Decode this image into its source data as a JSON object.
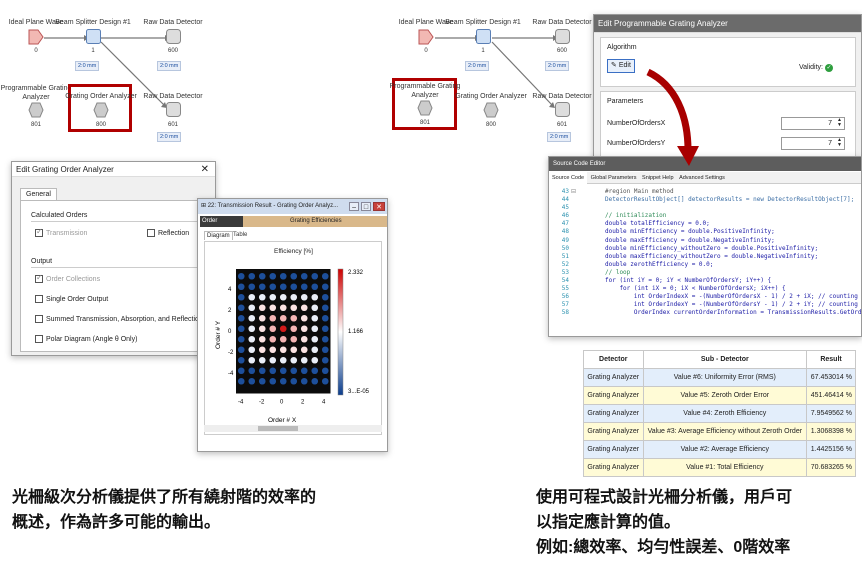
{
  "left_diagram": {
    "nodes": [
      {
        "label": "Ideal Plane Wave",
        "num": "0"
      },
      {
        "label": "Beam Splitter Design #1",
        "num": "1"
      },
      {
        "label": "Raw Data Detector",
        "num": "600"
      },
      {
        "label": "Programmable Grating Analyzer",
        "num": "801"
      },
      {
        "label": "Grating Order Analyzer",
        "num": "800"
      },
      {
        "label": "Raw Data Detector",
        "num": "601"
      }
    ],
    "ribbons": [
      "2:0 mm",
      "2:0 mm",
      "2:0 mm",
      "2:0 mm"
    ]
  },
  "right_diagram": {
    "nodes": [
      {
        "label": "Ideal Plane Wave",
        "num": "0"
      },
      {
        "label": "Beam Splitter Design #1",
        "num": "1"
      },
      {
        "label": "Raw Data Detector",
        "num": "600"
      },
      {
        "label": "Programmable Grating Analyzer",
        "num": "801"
      },
      {
        "label": "Grating Order Analyzer",
        "num": "800"
      },
      {
        "label": "Raw Data Detector",
        "num": "601"
      }
    ],
    "ribbons": [
      "2:0 mm",
      "2:0 mm",
      "2:0 mm",
      "2:0 mm"
    ]
  },
  "edit_dialog": {
    "title": "Edit Grating Order Analyzer",
    "tab": "General",
    "calculated_orders": "Calculated Orders",
    "transmission": "Transmission",
    "reflection": "Reflection",
    "output": "Output",
    "order_collections": "Order Collections",
    "single_order_output": "Single Order Output",
    "summed": "Summed Transmission, Absorption, and Reflection",
    "polar": "Polar Diagram (Angle θ Only)"
  },
  "result_window": {
    "title": "22: Transmission Result - Grating Order Analyz...",
    "col_collection": "Order Collection",
    "col_efficiencies": "Grating Efficiencies",
    "tab_diagram": "Diagram",
    "tab_table": "Table",
    "plot_title": "Efficiency  [%]",
    "ylabel": "Order # Y",
    "xlabel": "Order # X",
    "colorbar": [
      "2.332",
      "1.166",
      "3...E-05"
    ],
    "xticks": [
      "-4",
      "-2",
      "0",
      "2",
      "4"
    ],
    "yticks": [
      "4",
      "2",
      "0",
      "-2",
      "-4"
    ]
  },
  "pga_dialog": {
    "title": "Edit Programmable Grating Analyzer",
    "algorithm": "Algorithm",
    "edit": "Edit",
    "validity": "Validity:",
    "parameters": "Parameters",
    "param1": "NumberOfOrdersX",
    "param1_value": "7",
    "param2": "NumberOfOrdersY",
    "param2_value": "7"
  },
  "source_editor": {
    "title": "Source Code Editor",
    "tabs": [
      "Source Code",
      "Global Parameters",
      "Snippet Help",
      "Advanced Settings"
    ],
    "line_numbers": [
      "43",
      "44",
      "45",
      "46",
      "47",
      "48",
      "49",
      "50",
      "51",
      "52",
      "53",
      "54",
      "55",
      "56",
      "57",
      "58"
    ],
    "lines": [
      "#region Main method",
      "DetectorResultObject[] detectorResults = new DetectorResultObject[7];",
      "",
      "// initialization",
      "double totalEfficiency = 0.0;",
      "double minEfficiency = double.PositiveInfinity;",
      "double maxEfficiency = double.NegativeInfinity;",
      "double minEfficiency_withoutZero = double.PositiveInfinity;",
      "double maxEfficiency_withoutZero = double.NegativeInfinity;",
      "double zerothEfficiency = 0.0;",
      "// loop",
      "for (int iY = 0; iY < NumberOfOrdersY; iY++) {",
      "    for (int iX = 0; iX < NumberOfOrdersX; iX++) {",
      "        int OrderIndexX = -(NumberOfOrdersX - 1) / 2 + iX; // counting",
      "        int OrderIndexY = -(NumberOfOrdersY - 1) / 2 + iY; // counting",
      "        OrderIndex currentOrderInformation = TransmissionResults.GetOrd"
    ]
  },
  "results_table": {
    "headers": [
      "Detector",
      "Sub - Detector",
      "Result"
    ],
    "rows": [
      [
        "Grating Analyzer",
        "Value #6: Uniformity Error (RMS)",
        "67.453014 %"
      ],
      [
        "Grating Analyzer",
        "Value #5: Zeroth Order Error",
        "451.46414 %"
      ],
      [
        "Grating Analyzer",
        "Value #4: Zeroth Efficiency",
        "7.9549562 %"
      ],
      [
        "Grating Analyzer",
        "Value #3: Average Efficiency without Zeroth Order",
        "1.3068398 %"
      ],
      [
        "Grating Analyzer",
        "Value #2: Average Efficiency",
        "1.4425156 %"
      ],
      [
        "Grating Analyzer",
        "Value #1: Total Efficiency",
        "70.683265 %"
      ]
    ]
  },
  "captions": {
    "left_1": "光柵級次分析儀提供了所有繞射階的效率的",
    "left_2": "概述，作為許多可能的輸出。",
    "right_1": "使用可程式設計光柵分析儀，用戶可",
    "right_2": "以指定應計算的值。",
    "right_3": "例如:總效率、均勻性誤差、0階效率"
  },
  "colors": {
    "highlight": "#b00000",
    "source_red": "#f4c7c3",
    "module_blue": "#cfe0f5",
    "row_yellow": "#fffbd6",
    "row_blue": "#e3eefb"
  }
}
